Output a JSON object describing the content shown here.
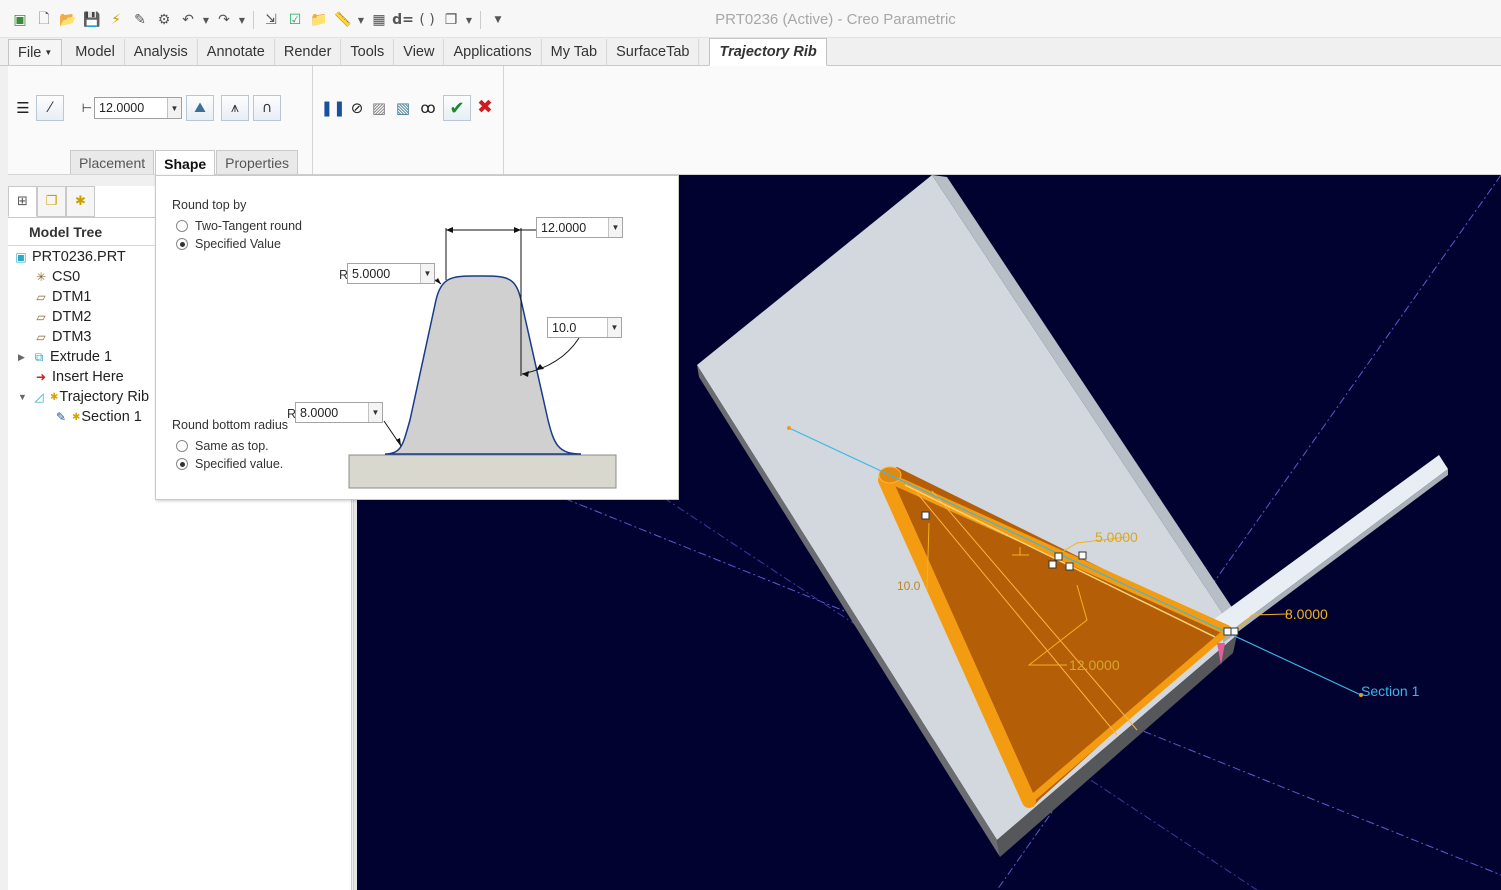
{
  "app": {
    "title": "PRT0236 (Active) - Creo Parametric"
  },
  "quick_access": {
    "icons": [
      "model-icon",
      "new-icon",
      "open-icon",
      "save-icon",
      "regenerate-icon",
      "regenerate-manager-icon",
      "window-icon",
      "undo-icon",
      "redo-icon",
      "close-icon",
      "verify-icon",
      "folder-icon",
      "measure-icon",
      "parameters-icon",
      "relations-icon",
      "braces-icon",
      "windows-icon",
      "customize-icon"
    ]
  },
  "tabs": {
    "file": "File",
    "items": [
      "Model",
      "Analysis",
      "Annotate",
      "Render",
      "Tools",
      "View",
      "Applications",
      "My Tab",
      "SurfaceTab"
    ],
    "active": "Trajectory Rib"
  },
  "ribbon": {
    "thickness_value": "12.0000",
    "subtabs": [
      "Placement",
      "Shape",
      "Properties"
    ],
    "active_subtab": "Shape"
  },
  "model_tree": {
    "title": "Model Tree",
    "items": [
      {
        "label": "PRT0236.PRT",
        "icon": "part-icon"
      },
      {
        "label": "CS0",
        "icon": "coordinate-system-icon"
      },
      {
        "label": "DTM1",
        "icon": "datum-plane-icon"
      },
      {
        "label": "DTM2",
        "icon": "datum-plane-icon"
      },
      {
        "label": "DTM3",
        "icon": "datum-plane-icon"
      },
      {
        "label": "Extrude 1",
        "icon": "extrude-icon"
      },
      {
        "label": "Insert Here",
        "icon": "insert-arrow-icon"
      },
      {
        "label": "Trajectory Rib",
        "icon": "rib-icon"
      },
      {
        "label": "Section 1",
        "icon": "sketch-icon"
      }
    ]
  },
  "shape_panel": {
    "round_top_label": "Round top by",
    "opt_two_tangent": "Two-Tangent round",
    "opt_specified_value": "Specified Value",
    "round_bottom_label": "Round bottom radius",
    "opt_same_as_top": "Same as top.",
    "opt_specified_value_bottom": "Specified value.",
    "top_width": "12.0000",
    "top_radius": "5.0000",
    "draft_angle": "10.0",
    "bottom_radius": "8.0000",
    "r_prefix": "R"
  },
  "viewport": {
    "dim_5": "5.0000",
    "dim_8": "8.0000",
    "dim_12": "12.0000",
    "dim_10": "10.0",
    "section_label": "Section 1",
    "colors": {
      "background": "#020230",
      "rib": "#f39c12",
      "plate": "#d0d6dc"
    }
  }
}
